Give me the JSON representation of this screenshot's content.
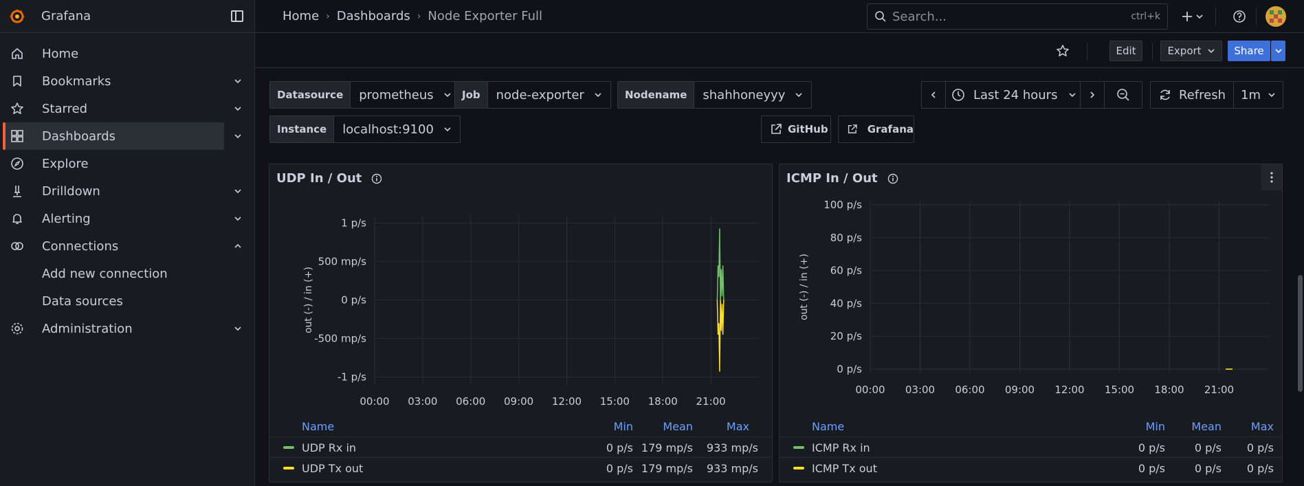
{
  "app": {
    "name": "Grafana"
  },
  "sidebar": {
    "items": [
      {
        "label": "Home"
      },
      {
        "label": "Bookmarks"
      },
      {
        "label": "Starred"
      },
      {
        "label": "Dashboards"
      },
      {
        "label": "Explore"
      },
      {
        "label": "Drilldown"
      },
      {
        "label": "Alerting"
      },
      {
        "label": "Connections"
      },
      {
        "label": "Add new connection"
      },
      {
        "label": "Data sources"
      },
      {
        "label": "Administration"
      }
    ]
  },
  "breadcrumb": {
    "home": "Home",
    "dashboards": "Dashboards",
    "current": "Node Exporter Full"
  },
  "search": {
    "placeholder": "Search...",
    "shortcut": "ctrl+k"
  },
  "toolbar": {
    "edit": "Edit",
    "export": "Export",
    "share": "Share"
  },
  "variables": [
    {
      "label": "Datasource",
      "value": "prometheus"
    },
    {
      "label": "Job",
      "value": "node-exporter"
    },
    {
      "label": "Nodename",
      "value": "shahhoneyyy"
    },
    {
      "label": "Instance",
      "value": "localhost:9100"
    }
  ],
  "time": {
    "range": "Last 24 hours",
    "refresh": "Refresh",
    "interval": "1m"
  },
  "links": {
    "github": "GitHub",
    "grafana": "Grafana"
  },
  "colors": {
    "accent": "#f55f3e",
    "primary": "#3d71d9",
    "green": "#73bf69",
    "yellow": "#fade2a",
    "legend_header": "#6e9fff"
  },
  "panels": [
    {
      "title": "UDP In / Out",
      "legend_headers": {
        "name": "Name",
        "min": "Min",
        "mean": "Mean",
        "max": "Max"
      },
      "rows": [
        {
          "name": "UDP Rx in",
          "min": "0 p/s",
          "mean": "179 mp/s",
          "max": "933 mp/s"
        },
        {
          "name": "UDP Tx out",
          "min": "0 p/s",
          "mean": "179 mp/s",
          "max": "933 mp/s"
        }
      ]
    },
    {
      "title": "ICMP In / Out",
      "legend_headers": {
        "name": "Name",
        "min": "Min",
        "mean": "Mean",
        "max": "Max"
      },
      "rows": [
        {
          "name": "ICMP Rx in",
          "min": "0 p/s",
          "mean": "0 p/s",
          "max": "0 p/s"
        },
        {
          "name": "ICMP Tx out",
          "min": "0 p/s",
          "mean": "0 p/s",
          "max": "0 p/s"
        }
      ]
    }
  ],
  "chart_data": [
    {
      "type": "line",
      "title": "UDP In / Out",
      "ylabel": "out (-) / in (+)",
      "x": [
        "00:00",
        "03:00",
        "06:00",
        "09:00",
        "12:00",
        "15:00",
        "18:00",
        "21:00"
      ],
      "yticks": [
        "1 p/s",
        "500 mp/s",
        "0 p/s",
        "-500 mp/s",
        "-1 p/s"
      ],
      "ylim": [
        -1.05,
        1.05
      ],
      "series": [
        {
          "name": "UDP Rx in",
          "color": "#73bf69",
          "points": [
            [
              21.4,
              0
            ],
            [
              21.45,
              0.45
            ],
            [
              21.5,
              0.3
            ],
            [
              21.55,
              0.93
            ],
            [
              21.6,
              0
            ],
            [
              21.65,
              0.4
            ],
            [
              21.7,
              0.05
            ],
            [
              21.75,
              0.45
            ],
            [
              21.8,
              0
            ]
          ]
        },
        {
          "name": "UDP Tx out",
          "color": "#fade2a",
          "points": [
            [
              21.4,
              0
            ],
            [
              21.45,
              -0.45
            ],
            [
              21.5,
              -0.3
            ],
            [
              21.55,
              -0.93
            ],
            [
              21.6,
              0
            ],
            [
              21.65,
              -0.4
            ],
            [
              21.7,
              -0.05
            ],
            [
              21.75,
              -0.45
            ],
            [
              21.8,
              0
            ]
          ]
        }
      ]
    },
    {
      "type": "line",
      "title": "ICMP In / Out",
      "ylabel": "out (-) / in (+)",
      "x": [
        "00:00",
        "03:00",
        "06:00",
        "09:00",
        "12:00",
        "15:00",
        "18:00",
        "21:00"
      ],
      "yticks": [
        "100 p/s",
        "80 p/s",
        "60 p/s",
        "40 p/s",
        "20 p/s",
        "0 p/s"
      ],
      "ylim": [
        0,
        100
      ],
      "series": [
        {
          "name": "ICMP Rx in",
          "color": "#73bf69",
          "points": [
            [
              21.4,
              0
            ],
            [
              21.8,
              0
            ]
          ]
        },
        {
          "name": "ICMP Tx out",
          "color": "#fade2a",
          "points": [
            [
              21.4,
              0
            ],
            [
              21.8,
              0
            ]
          ]
        }
      ]
    }
  ]
}
